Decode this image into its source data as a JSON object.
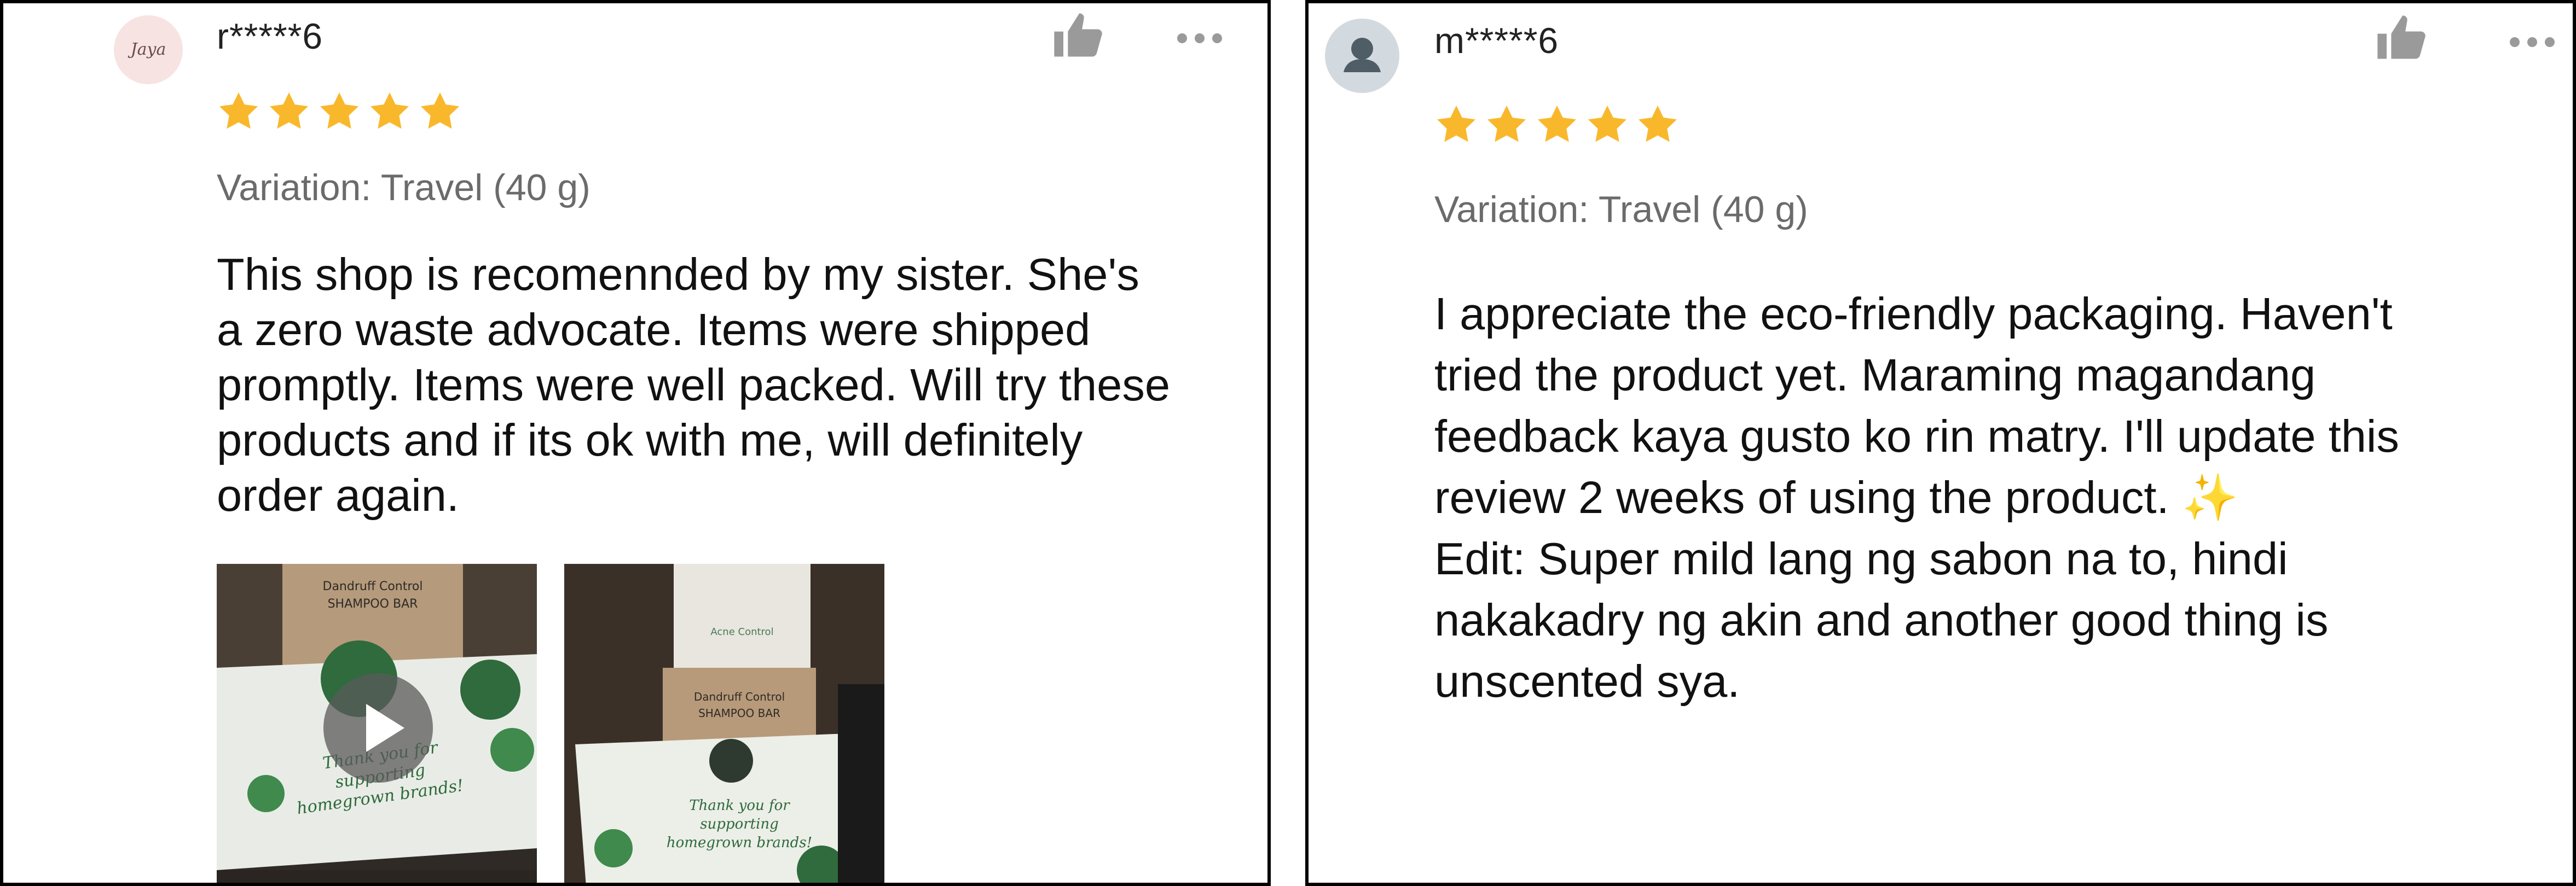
{
  "colors": {
    "star": "#f9b82c",
    "text": "#111111",
    "muted": "#6b6b6b",
    "border": "#000000",
    "sparkle": "#f3b73d"
  },
  "reviews": [
    {
      "username": "r*****6",
      "avatar_text": "Jaya",
      "rating": 5,
      "variation": "Variation: Travel (40 g)",
      "text": "This shop is recomennded by my sister. She's\na zero waste advocate. Items were shipped\npromptly. Items were well packed. Will try these\nproducts and if its ok with me, will definitely\norder again.",
      "media": [
        {
          "type": "video",
          "box_label_line1": "Dandruff Control",
          "box_label_line2": "SHAMPOO BAR",
          "card_text_line1": "Thank you for",
          "card_text_line2": "supporting",
          "card_text_line3": "homegrown brands!"
        },
        {
          "type": "image",
          "box_top_label": "Acne Control",
          "box_label_line1": "Dandruff Control",
          "box_label_line2": "SHAMPOO BAR",
          "card_text_line1": "Thank you for",
          "card_text_line2": "supporting",
          "card_text_line3": "homegrown brands!"
        }
      ]
    },
    {
      "username": "m*****6",
      "rating": 5,
      "variation": "Variation: Travel (40 g)",
      "text_para1": "I appreciate the eco-friendly packaging. Haven't\ntried the product yet. Maraming magandang\nfeedback kaya gusto ko rin matry. I'll update this\nreview 2 weeks of using the product. ",
      "sparkle": "✨",
      "text_para2": "Edit: Super mild lang ng sabon na to, hindi\nnakakadry ng akin and another good thing is\nunscented sya."
    }
  ]
}
